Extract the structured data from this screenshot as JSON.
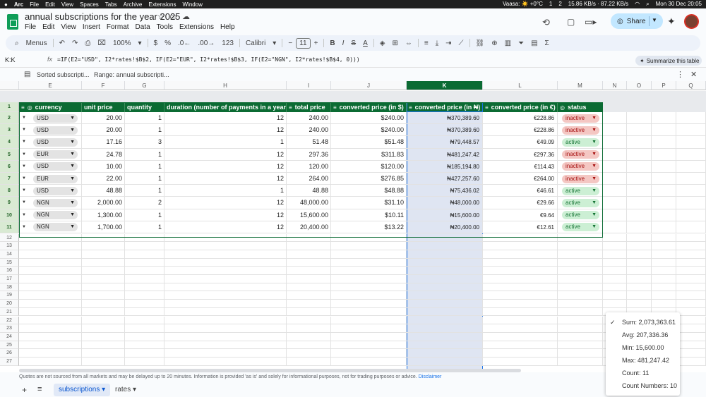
{
  "menubar": {
    "apple": "",
    "app": "Arc",
    "items": [
      "File",
      "Edit",
      "View",
      "Spaces",
      "Tabs",
      "Archive",
      "Extensions",
      "Window"
    ],
    "weather": "Vaasa: ☀️ +0°C",
    "counter1": "1",
    "counter2": "2",
    "network": "15.86 KB/s · 87.22 KB/s",
    "datetime": "Mon 30 Dec  20:05"
  },
  "doc": {
    "title": "annual subscriptions for the year 2025",
    "menu": [
      "File",
      "Edit",
      "View",
      "Insert",
      "Format",
      "Data",
      "Tools",
      "Extensions",
      "Help"
    ],
    "share_label": "Share"
  },
  "toolbar": {
    "menus_label": "Menus",
    "zoom": "100%",
    "currency": "$",
    "percent": "%",
    "number_format": "123",
    "font": "Calibri",
    "font_size": "11"
  },
  "formula": {
    "name_box": "K:K",
    "text": "=IF(E2=\"USD\", I2*rates!$B$2, IF(E2=\"EUR\", I2*rates!$B$3, IF(E2=\"NGN\", I2*rates!$B$4, 0)))",
    "summarize_label": "Summarize this table"
  },
  "filterbar": {
    "sorted": "Sorted subscripti...",
    "range": "Range:  annual subscripti..."
  },
  "columns": [
    {
      "letter": "E",
      "header": "currency"
    },
    {
      "letter": "F",
      "header": "unit price"
    },
    {
      "letter": "G",
      "header": "quantity"
    },
    {
      "letter": "H",
      "header": "duration (number of payments in a year)"
    },
    {
      "letter": "I",
      "header": "total price"
    },
    {
      "letter": "J",
      "header": "converted price (in $)"
    },
    {
      "letter": "K",
      "header": "converted price (in ₦)"
    },
    {
      "letter": "L",
      "header": "converted price (in €)"
    },
    {
      "letter": "M",
      "header": "status"
    },
    {
      "letter": "N",
      "header": ""
    },
    {
      "letter": "O",
      "header": ""
    },
    {
      "letter": "P",
      "header": ""
    },
    {
      "letter": "Q",
      "header": ""
    }
  ],
  "rows": [
    {
      "n": "2",
      "currency": "USD",
      "unit": "20.00",
      "qty": "1",
      "dur": "12",
      "total": "240.00",
      "usd": "$240.00",
      "ngn": "₦370,389.60",
      "eur": "€228.86",
      "status": "inactive"
    },
    {
      "n": "3",
      "currency": "USD",
      "unit": "20.00",
      "qty": "1",
      "dur": "12",
      "total": "240.00",
      "usd": "$240.00",
      "ngn": "₦370,389.60",
      "eur": "€228.86",
      "status": "inactive"
    },
    {
      "n": "4",
      "currency": "USD",
      "unit": "17.16",
      "qty": "3",
      "dur": "1",
      "total": "51.48",
      "usd": "$51.48",
      "ngn": "₦79,448.57",
      "eur": "€49.09",
      "status": "active"
    },
    {
      "n": "5",
      "currency": "EUR",
      "unit": "24.78",
      "qty": "1",
      "dur": "12",
      "total": "297.36",
      "usd": "$311.83",
      "ngn": "₦481,247.42",
      "eur": "€297.36",
      "status": "inactive"
    },
    {
      "n": "6",
      "currency": "USD",
      "unit": "10.00",
      "qty": "1",
      "dur": "12",
      "total": "120.00",
      "usd": "$120.00",
      "ngn": "₦185,194.80",
      "eur": "€114.43",
      "status": "inactive"
    },
    {
      "n": "7",
      "currency": "EUR",
      "unit": "22.00",
      "qty": "1",
      "dur": "12",
      "total": "264.00",
      "usd": "$276.85",
      "ngn": "₦427,257.60",
      "eur": "€264.00",
      "status": "inactive"
    },
    {
      "n": "8",
      "currency": "USD",
      "unit": "48.88",
      "qty": "1",
      "dur": "1",
      "total": "48.88",
      "usd": "$48.88",
      "ngn": "₦75,436.02",
      "eur": "€46.61",
      "status": "active"
    },
    {
      "n": "9",
      "currency": "NGN",
      "unit": "2,000.00",
      "qty": "2",
      "dur": "12",
      "total": "48,000.00",
      "usd": "$31.10",
      "ngn": "₦48,000.00",
      "eur": "€29.66",
      "status": "active"
    },
    {
      "n": "10",
      "currency": "NGN",
      "unit": "1,300.00",
      "qty": "1",
      "dur": "12",
      "total": "15,600.00",
      "usd": "$10.11",
      "ngn": "₦15,600.00",
      "eur": "€9.64",
      "status": "active"
    },
    {
      "n": "11",
      "currency": "NGN",
      "unit": "1,700.00",
      "qty": "1",
      "dur": "12",
      "total": "20,400.00",
      "usd": "$13.22",
      "ngn": "₦20,400.00",
      "eur": "€12.61",
      "status": "active"
    }
  ],
  "empty_rows": [
    "12",
    "13",
    "14",
    "15",
    "16",
    "17",
    "18",
    "19",
    "20",
    "21",
    "22",
    "23",
    "24",
    "25",
    "26",
    "27"
  ],
  "header_row_number": "1",
  "status_colors": {
    "active_bg": "#ccefd4",
    "active_fg": "#137333",
    "inactive_bg": "#f4c7c3",
    "inactive_fg": "#a50e0e",
    "header_green": "#0b6b33"
  },
  "statusbar": {
    "text": "Quotes are not sourced from all markets and may be delayed up to 20 minutes. Information is provided 'as is' and solely for informational purposes, not for trading purposes or advice.",
    "link": "Disclaimer"
  },
  "tabs": {
    "active": "subscriptions",
    "other": "rates"
  },
  "stats": {
    "sum": "Sum: 2,073,363.61",
    "avg": "Avg: 207,336.36",
    "min": "Min: 15,600.00",
    "max": "Max: 481,247.42",
    "count": "Count: 11",
    "count_numbers": "Count Numbers: 10"
  }
}
